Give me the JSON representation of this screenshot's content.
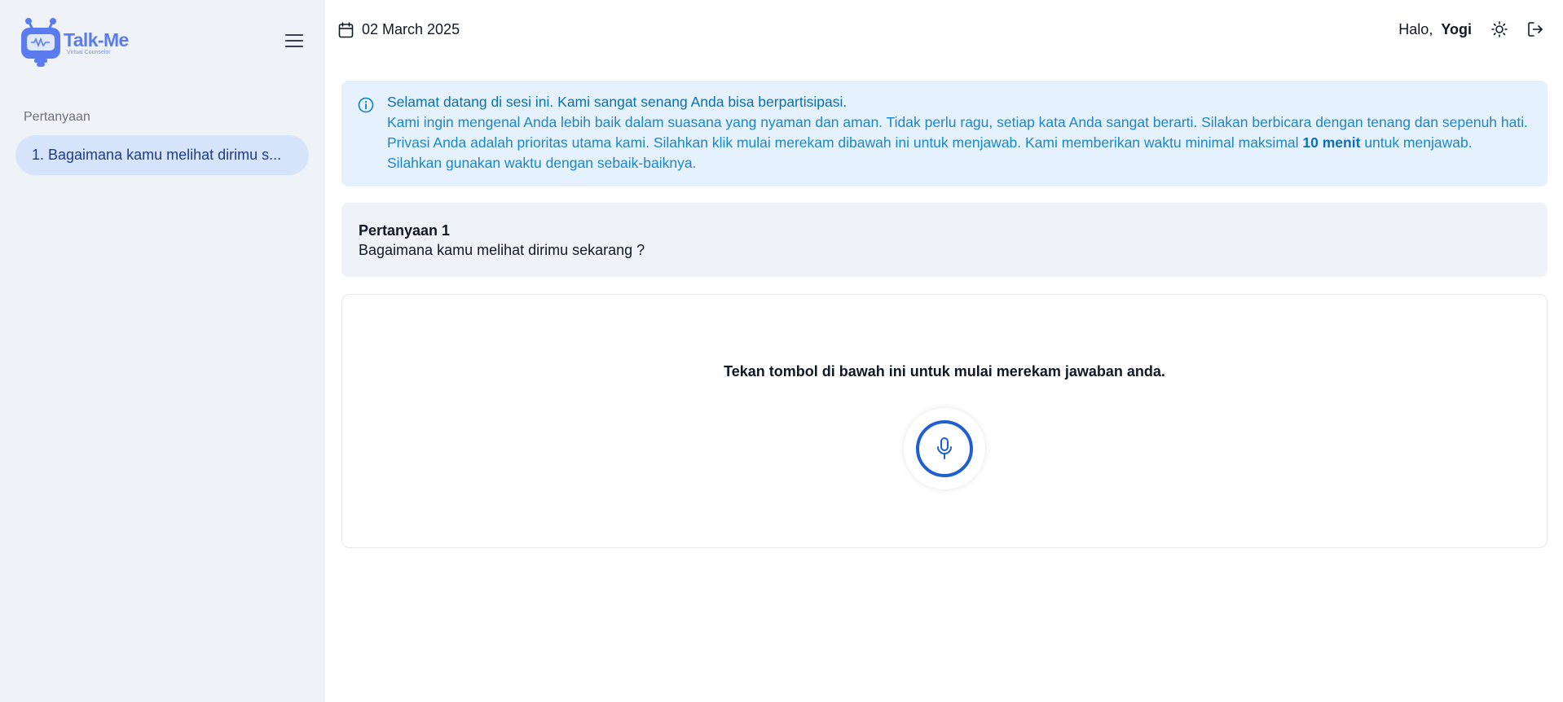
{
  "app": {
    "logo_title": "Talk-Me",
    "logo_subtitle": "Virtual Counselor",
    "brand_color": "#5b7cf0"
  },
  "sidebar": {
    "section_label": "Pertanyaan",
    "items": [
      {
        "label": "1. Bagaimana kamu melihat dirimu s..."
      }
    ]
  },
  "header": {
    "date": "02 March 2025",
    "greeting": "Halo,",
    "username": "Yogi",
    "icons": [
      "calendar-icon",
      "sun-icon",
      "logout-icon",
      "hamburger-menu-icon"
    ]
  },
  "info": {
    "title": "Selamat datang di sesi ini. Kami sangat senang Anda bisa berpartisipasi.",
    "body_before": "Kami ingin mengenal Anda lebih baik dalam suasana yang nyaman dan aman. Tidak perlu ragu, setiap kata Anda sangat berarti. Silakan berbicara dengan tenang dan sepenuh hati. Privasi Anda adalah prioritas utama kami. Silahkan klik mulai merekam dibawah ini untuk menjawab. Kami memberikan waktu minimal maksimal ",
    "body_bold": "10 menit",
    "body_after": " untuk menjawab. Silahkan gunakan waktu dengan sebaik-baiknya."
  },
  "question": {
    "title": "Pertanyaan 1",
    "text": "Bagaimana kamu melihat dirimu sekarang ?"
  },
  "record": {
    "prompt": "Tekan tombol di bawah ini untuk mulai merekam jawaban anda.",
    "accent_color": "#1f5fcf"
  }
}
